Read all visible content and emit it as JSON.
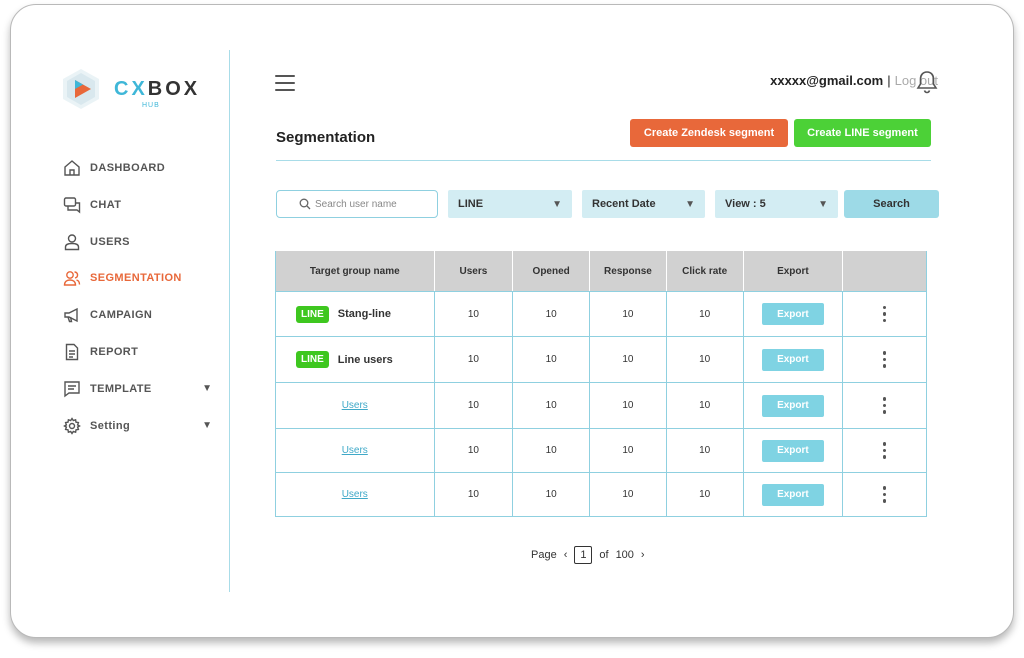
{
  "brand": {
    "name_part1": "CX",
    "name_part2": "BOX",
    "sub": "HUB",
    "accent_color": "#3fb7d8",
    "play_color": "#e8683a"
  },
  "sidebar": {
    "items": [
      {
        "label": "DASHBOARD",
        "icon": "home-icon"
      },
      {
        "label": "CHAT",
        "icon": "chat-icon"
      },
      {
        "label": "USERS",
        "icon": "user-icon"
      },
      {
        "label": "SEGMENTATION",
        "icon": "users-segment-icon",
        "active": true
      },
      {
        "label": "CAMPAIGN",
        "icon": "megaphone-icon"
      },
      {
        "label": "REPORT",
        "icon": "document-icon"
      },
      {
        "label": "TEMPLATE",
        "icon": "template-icon",
        "expandable": true
      },
      {
        "label": "Setting",
        "icon": "gear-icon",
        "expandable": true
      }
    ],
    "caret": "▼",
    "active_color": "#e8683a"
  },
  "header": {
    "email": "xxxxx@gmail.com",
    "separator": "|",
    "logout": "Log out"
  },
  "page": {
    "title": "Segmentation",
    "create_zendesk_label": "Create Zendesk segment",
    "create_line_label": "Create LINE segment",
    "zendesk_color": "#e8683a",
    "line_color": "#4cd137"
  },
  "filters": {
    "search_placeholder": "Search user name",
    "channel": "LINE",
    "sort": "Recent Date",
    "view": "View : 5",
    "search_button": "Search",
    "caret": "▼"
  },
  "table": {
    "headers": [
      "Target group name",
      "Users",
      "Opened",
      "Response",
      "Click rate",
      "Export",
      ""
    ],
    "rows": [
      {
        "badge": "LINE",
        "name": "Stang-line",
        "users": "10",
        "opened": "10",
        "response": "10",
        "click_rate": "10",
        "export": "Export"
      },
      {
        "badge": "LINE",
        "name": "Line users",
        "users": "10",
        "opened": "10",
        "response": "10",
        "click_rate": "10",
        "export": "Export"
      },
      {
        "link": "Users",
        "users": "10",
        "opened": "10",
        "response": "10",
        "click_rate": "10",
        "export": "Export"
      },
      {
        "link": "Users",
        "users": "10",
        "opened": "10",
        "response": "10",
        "click_rate": "10",
        "export": "Export"
      },
      {
        "link": "Users",
        "users": "10",
        "opened": "10",
        "response": "10",
        "click_rate": "10",
        "export": "Export"
      }
    ]
  },
  "pagination": {
    "label": "Page",
    "prev": "‹",
    "current": "1",
    "of_label": "of",
    "total": "100",
    "next": "›"
  }
}
